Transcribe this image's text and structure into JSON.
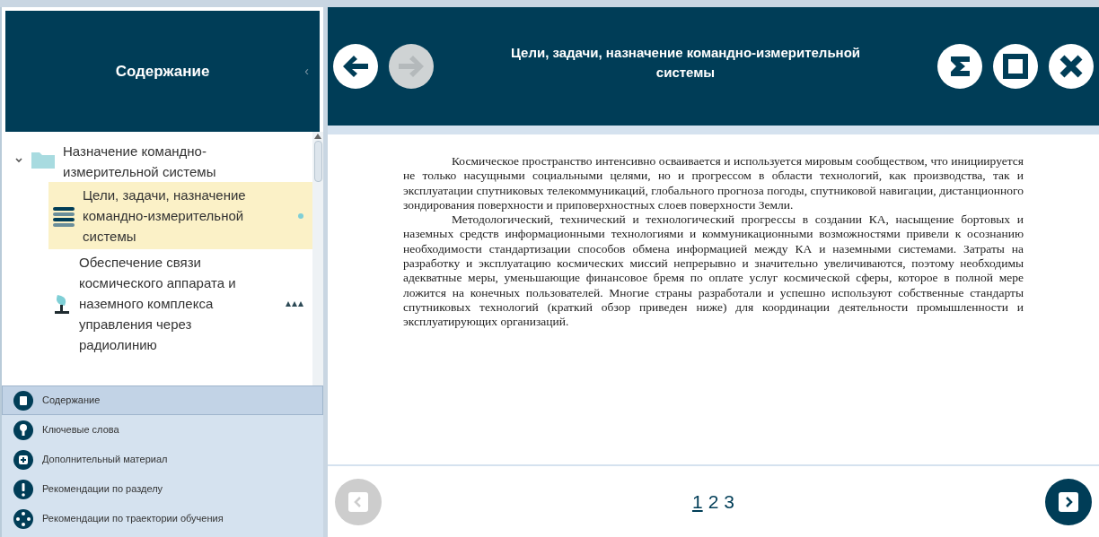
{
  "sidebar": {
    "title": "Содержание",
    "collapse_glyph": "‹",
    "tree": [
      {
        "label": "Назначение командно-измерительной системы",
        "expanded": true,
        "children": [
          {
            "label": "Цели, задачи, назначение командно-измерительной системы",
            "selected": true,
            "kind": "list"
          },
          {
            "label": "Обеспечение связи космического аппарата и наземного комплекса управления через радиолинию",
            "selected": false,
            "kind": "dish"
          }
        ]
      }
    ],
    "nav": [
      {
        "label": "Содержание",
        "selected": true,
        "kind": "contents"
      },
      {
        "label": "Ключевые слова",
        "selected": false,
        "kind": "key"
      },
      {
        "label": "Дополнительный материал",
        "selected": false,
        "kind": "plus"
      },
      {
        "label": "Рекомендации по разделу",
        "selected": false,
        "kind": "alert"
      },
      {
        "label": "Рекомендации по траектории обучения",
        "selected": false,
        "kind": "path"
      }
    ]
  },
  "header": {
    "title": "Цели, задачи, назначение командно-измерительной системы",
    "back_disabled": false,
    "forward_disabled": true
  },
  "document": {
    "paragraphs": [
      "Космическое пространство интенсивно осваивается и используется мировым сообществом, что инициируется не только насущными социальными целями, но и прогрессом в области технологий, как производства, так и эксплуатации спутниковых телекоммуникаций, глобального прогноза погоды, спутниковой навигации, дистанционного зондирования поверхности и приповерхностных слоев поверхности Земли.",
      "Методологический, технический и технологический прогрессы в создании КА, насыщение бортовых и наземных средств информационными технологиями и коммуникационными возможностями привели к осознанию необходимости стандартизации способов обмена информацией между КА и наземными системами. Затраты на разработку и эксплуатацию космических миссий непрерывно и значительно увеличиваются, поэтому необходимы адекватные меры, уменьшающие финансовое бремя по оплате услуг космической сферы, которое в полной мере ложится на конечных пользователей. Многие страны разработали и успешно используют собственные стандарты спутниковых технологий (краткий обзор приведен ниже) для координации деятельности промышленности и эксплуатирующих организаций."
    ]
  },
  "pager": {
    "prev_disabled": true,
    "next_disabled": false,
    "pages": [
      {
        "label": "1",
        "selected": true
      },
      {
        "label": "2",
        "selected": false
      },
      {
        "label": "3",
        "selected": false
      }
    ]
  }
}
